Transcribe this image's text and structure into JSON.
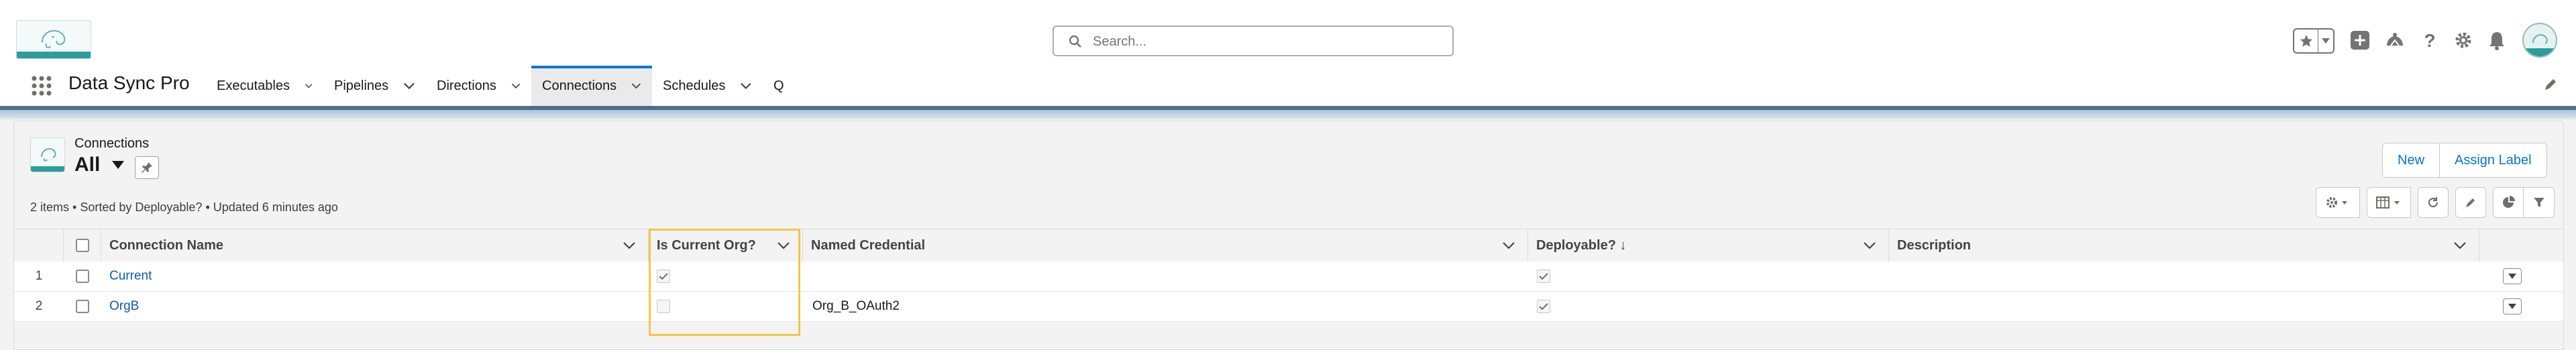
{
  "header": {
    "search_placeholder": "Search...",
    "icons": [
      "favorites-star-icon",
      "add-icon",
      "trailhead-icon",
      "help-icon",
      "setup-gear-icon",
      "notifications-bell-icon"
    ]
  },
  "nav": {
    "app_name": "Data Sync Pro",
    "items": [
      {
        "label": "Executables",
        "active": false
      },
      {
        "label": "Pipelines",
        "active": false
      },
      {
        "label": "Directions",
        "active": false
      },
      {
        "label": "Connections",
        "active": true
      },
      {
        "label": "Schedules",
        "active": false
      },
      {
        "label": "Q",
        "active": false
      }
    ]
  },
  "list_view": {
    "object_label": "Connections",
    "view_name": "All",
    "info": "2 items • Sorted by Deployable? • Updated 6 minutes ago",
    "buttons": {
      "new": "New",
      "assign_label": "Assign Label"
    }
  },
  "table": {
    "columns": {
      "name": "Connection Name",
      "is_current": "Is Current Org?",
      "named_credential": "Named Credential",
      "deployable": "Deployable? ↓",
      "description": "Description"
    },
    "rows": [
      {
        "num": "1",
        "name": "Current",
        "is_current": true,
        "named_credential": "",
        "deployable": true,
        "description": ""
      },
      {
        "num": "2",
        "name": "OrgB",
        "is_current": false,
        "named_credential": "Org_B_OAuth2",
        "deployable": true,
        "description": ""
      }
    ]
  },
  "colors": {
    "accent": "#0176d3",
    "link": "#0b5cab",
    "highlight": "#f2c744",
    "nav_border": "#4b6e8e"
  }
}
